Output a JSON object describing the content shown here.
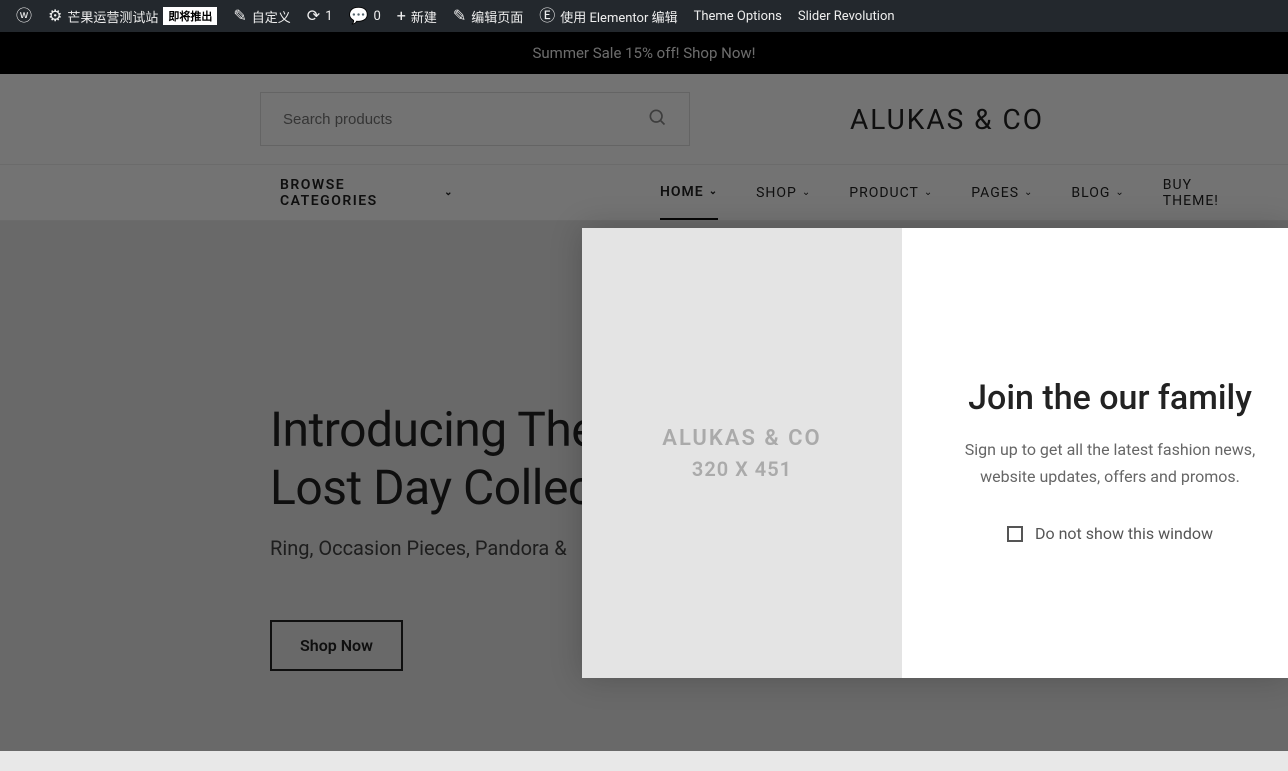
{
  "adminBar": {
    "siteName": "芒果运营测试站",
    "badge": "即将推出",
    "customize": "自定义",
    "updates": "1",
    "comments": "0",
    "newItem": "新建",
    "editPage": "编辑页面",
    "elementor": "使用 Elementor 编辑",
    "themeOptions": "Theme Options",
    "sliderRev": "Slider Revolution"
  },
  "promoBar": "Summer Sale 15% off! Shop Now!",
  "search": {
    "placeholder": "Search products"
  },
  "logo": "ALUKAS & CO",
  "nav": {
    "browse": "BROWSE CATEGORIES",
    "items": [
      {
        "label": "HOME"
      },
      {
        "label": "SHOP"
      },
      {
        "label": "PRODUCT"
      },
      {
        "label": "PAGES"
      },
      {
        "label": "BLOG"
      },
      {
        "label": "BUY THEME!"
      }
    ]
  },
  "hero": {
    "title1": "Introducing The",
    "title2": "Lost Day Collection",
    "subtitle": "Ring, Occasion Pieces, Pandora &",
    "button": "Shop Now"
  },
  "modal": {
    "placeholderTitle": "ALUKAS & CO",
    "placeholderDim": "320 X 451",
    "title": "Join the our family",
    "subtitle": "Sign up to get all the latest fashion news, website updates, offers and promos.",
    "checkbox": "Do not show this window"
  }
}
